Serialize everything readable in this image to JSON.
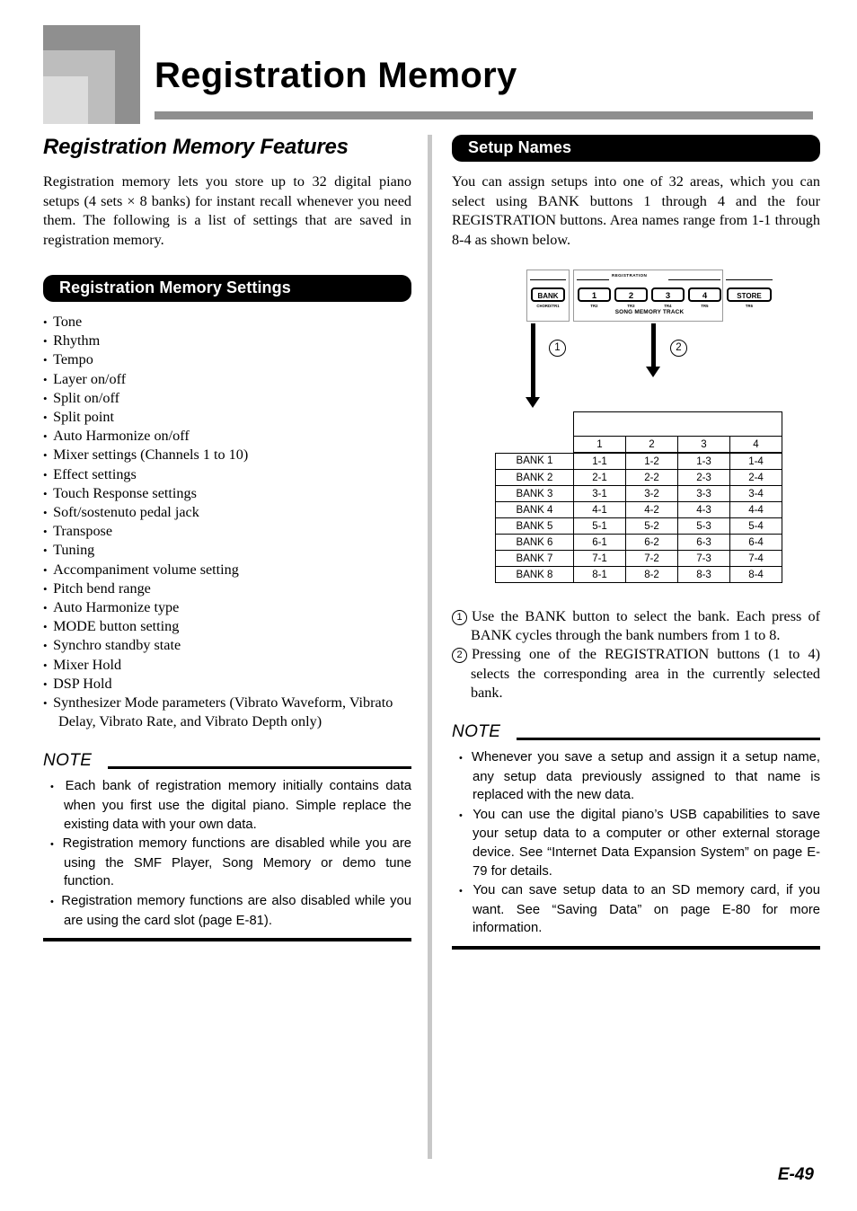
{
  "header": {
    "chapter_title": "Registration Memory"
  },
  "left": {
    "features_heading": "Registration Memory Features",
    "intro_paragraph": "Registration memory lets you store up to 32 digital piano setups (4 sets × 8 banks) for instant recall whenever you need them. The following is a list of settings that are saved in registration memory.",
    "settings_bar": "Registration Memory Settings",
    "settings_items": [
      "Tone",
      "Rhythm",
      "Tempo",
      "Layer on/off",
      "Split on/off",
      "Split point",
      "Auto Harmonize on/off",
      "Mixer settings (Channels 1 to 10)",
      "Effect settings",
      "Touch Response settings",
      "Soft/sostenuto pedal jack",
      "Transpose",
      "Tuning",
      "Accompaniment volume setting",
      "Pitch bend range",
      "Auto Harmonize type",
      "MODE button setting",
      "Synchro standby state",
      "Mixer Hold",
      "DSP Hold",
      "Synthesizer Mode parameters (Vibrato Waveform, Vibrato Delay, Vibrato Rate, and Vibrato Depth only)"
    ],
    "note_label": "NOTE",
    "note_items": [
      "Each bank of registration memory initially contains data when you first use the digital piano. Simple replace the existing data with your own data.",
      "Registration memory functions are disabled while you are using the SMF Player, Song Memory or demo tune function.",
      "Registration memory functions are also disabled while you are using the card slot (page E-81)."
    ]
  },
  "right": {
    "setup_names_bar": "Setup Names",
    "intro_paragraph": "You can assign setups into one of 32 areas, which you can select using BANK buttons 1 through 4 and the four REGISTRATION buttons. Area names range from 1-1 through 8-4 as shown below.",
    "panel": {
      "bank_key": "BANK",
      "bank_sub": "CHORD/TR1",
      "registration_caption": "REGISTRATION",
      "song_memory_track_caption": "SONG MEMORY TRACK",
      "reg_keys": [
        "1",
        "2",
        "3",
        "4"
      ],
      "reg_subs": [
        "TR2",
        "TR3",
        "TR4",
        "TR5"
      ],
      "store_key": "STORE",
      "store_sub": "TR6"
    },
    "callouts": [
      "1",
      "2"
    ],
    "table": {
      "column_headers": [
        "1",
        "2",
        "3",
        "4"
      ],
      "rows": [
        {
          "bank": "BANK 1",
          "cells": [
            "1-1",
            "1-2",
            "1-3",
            "1-4"
          ]
        },
        {
          "bank": "BANK 2",
          "cells": [
            "2-1",
            "2-2",
            "2-3",
            "2-4"
          ]
        },
        {
          "bank": "BANK 3",
          "cells": [
            "3-1",
            "3-2",
            "3-3",
            "3-4"
          ]
        },
        {
          "bank": "BANK 4",
          "cells": [
            "4-1",
            "4-2",
            "4-3",
            "4-4"
          ]
        },
        {
          "bank": "BANK 5",
          "cells": [
            "5-1",
            "5-2",
            "5-3",
            "5-4"
          ]
        },
        {
          "bank": "BANK 6",
          "cells": [
            "6-1",
            "6-2",
            "6-3",
            "6-4"
          ]
        },
        {
          "bank": "BANK 7",
          "cells": [
            "7-1",
            "7-2",
            "7-3",
            "7-4"
          ]
        },
        {
          "bank": "BANK 8",
          "cells": [
            "8-1",
            "8-2",
            "8-3",
            "8-4"
          ]
        }
      ]
    },
    "numbered_items": [
      {
        "num": "1",
        "text": "Use the BANK button to select the bank. Each press of BANK cycles through the bank numbers from 1 to 8."
      },
      {
        "num": "2",
        "text": "Pressing one of the REGISTRATION buttons (1 to 4) selects the corresponding area in the currently selected bank."
      }
    ],
    "note_label": "NOTE",
    "note_items": [
      "Whenever you save a setup and assign it a setup name, any setup data previously assigned to that name is replaced with the new data.",
      "You can use the digital piano’s USB capabilities to save your setup data to a computer or other external storage device. See “Internet Data Expansion System” on page E-79 for details.",
      "You can save setup data to an SD memory card, if you want. See “Saving Data” on page E-80 for more information."
    ]
  },
  "footer": {
    "page_number": "E-49"
  }
}
